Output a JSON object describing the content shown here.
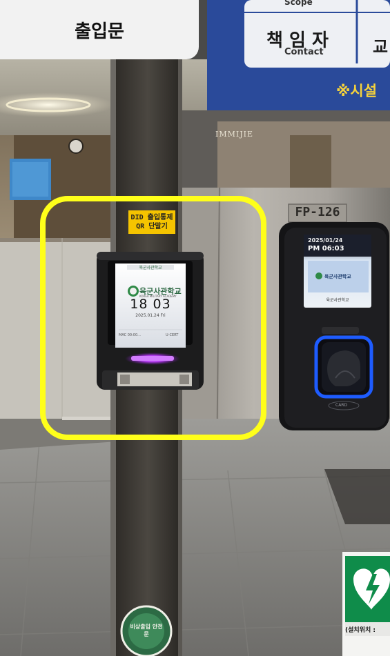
{
  "caption": "출입문",
  "sign": {
    "top_partial": "Scope",
    "role_label": "책 임 자",
    "role_english": "Contact",
    "right_partial": "교",
    "bottom_partial": "※시설"
  },
  "wall_logo": "IMMIJIE",
  "qr_terminal": {
    "sticker_line1": "DID 출입통제",
    "sticker_line2": "QR 단말기",
    "screen_header": "육군사관학교",
    "screen_school": "육군사관학교",
    "screen_school_en": "KOREA MILITARY ACADEMY",
    "screen_time": "18 03",
    "screen_date": "2025.01.24 Fri",
    "screen_footer_left": "MAC 00:00...",
    "screen_footer_right": "U-CERT"
  },
  "fingerprint_terminal": {
    "model_label": "FP-126",
    "screen_date": "2025/01/24",
    "screen_time": "PM 06:03",
    "screen_school": "육군사관학교",
    "screen_caption": "육군사관학교",
    "card_label": "CARD"
  },
  "pillar_sticker": "비상출입 안전문",
  "aed_sign_partial": "(설치위치 :",
  "accent_colors": {
    "highlight_outline": "#ffff1a",
    "sign_blue": "#2a4a9a",
    "qr_led": "#c24bff",
    "fingerprint_glow": "#1e5cff"
  }
}
